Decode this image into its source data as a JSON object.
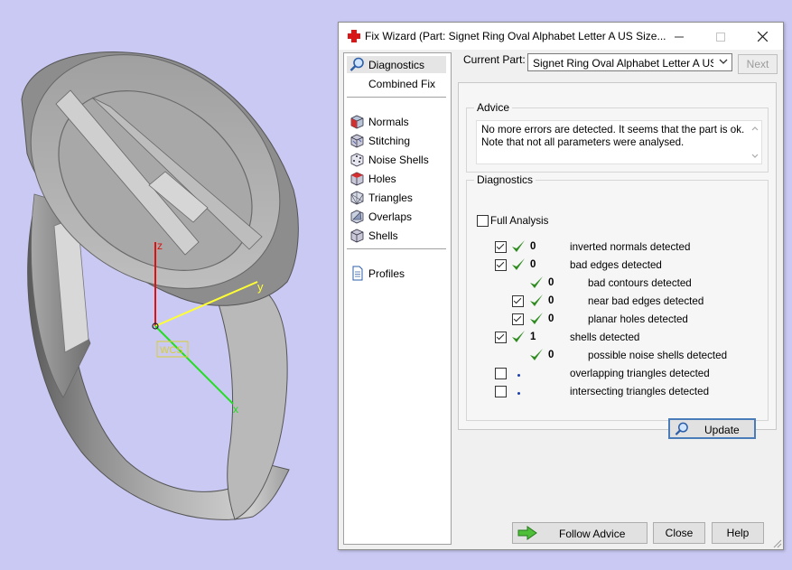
{
  "viewport": {
    "axis_labels": {
      "z": "z",
      "y": "y",
      "x": "x"
    },
    "wcs_label": "WCS",
    "colors": {
      "background": "#c9c9f3",
      "z_axis": "#e01010",
      "y_axis": "#ffff33",
      "x_axis": "#22dd22"
    }
  },
  "window": {
    "title": "Fix Wizard (Part: Signet Ring Oval Alphabet Letter A US Size...",
    "icons": {
      "app": "red-cross-icon",
      "minimize": "minimize-icon",
      "maximize": "maximize-icon",
      "close": "close-icon"
    }
  },
  "nav": {
    "items": [
      {
        "label": "Diagnostics",
        "icon": "magnifier-icon",
        "selected": true
      },
      {
        "label": "Combined Fix",
        "icon": "none"
      },
      {
        "label": "Normals",
        "icon": "normals-cube-icon"
      },
      {
        "label": "Stitching",
        "icon": "stitching-cube-icon"
      },
      {
        "label": "Noise Shells",
        "icon": "noise-dice-icon"
      },
      {
        "label": "Holes",
        "icon": "holes-cube-icon"
      },
      {
        "label": "Triangles",
        "icon": "triangles-icon"
      },
      {
        "label": "Overlaps",
        "icon": "overlaps-icon"
      },
      {
        "label": "Shells",
        "icon": "shells-icon"
      },
      {
        "label": "Profiles",
        "icon": "document-icon"
      }
    ]
  },
  "top": {
    "current_part_label": "Current Part:",
    "current_part_value": "Signet Ring Oval Alphabet Letter A US Size",
    "next_label": "Next"
  },
  "advice": {
    "group_title": "Advice",
    "line1": "No more errors are detected. It seems that the part is ok.",
    "line2": "Note that not all parameters were analysed."
  },
  "diagnostics": {
    "group_title": "Diagnostics",
    "full_analysis_label": "Full Analysis",
    "full_analysis_checked": false,
    "rows": [
      {
        "checked": true,
        "status": "ok",
        "count": "0",
        "label": "inverted normals detected",
        "indent": 0
      },
      {
        "checked": true,
        "status": "ok",
        "count": "0",
        "label": "bad edges detected",
        "indent": 0
      },
      {
        "checked": null,
        "status": "ok",
        "count": "0",
        "label": "bad contours detected",
        "indent": 1
      },
      {
        "checked": true,
        "status": "ok",
        "count": "0",
        "label": "near bad edges detected",
        "indent": 1
      },
      {
        "checked": true,
        "status": "ok",
        "count": "0",
        "label": "planar holes detected",
        "indent": 1
      },
      {
        "checked": true,
        "status": "ok",
        "count": "1",
        "label": "shells detected",
        "indent": 0
      },
      {
        "checked": null,
        "status": "ok",
        "count": "0",
        "label": "possible noise shells detected",
        "indent": 1
      },
      {
        "checked": false,
        "status": "pending",
        "count": "",
        "label": "overlapping triangles detected",
        "indent": 0
      },
      {
        "checked": false,
        "status": "pending",
        "count": "",
        "label": "intersecting triangles detected",
        "indent": 0
      }
    ],
    "update_label": "Update",
    "colors": {
      "tick": "#2e8b1f",
      "pending_dot": "#1b3fb0"
    }
  },
  "buttons": {
    "follow_advice": "Follow Advice",
    "close": "Close",
    "help": "Help"
  }
}
